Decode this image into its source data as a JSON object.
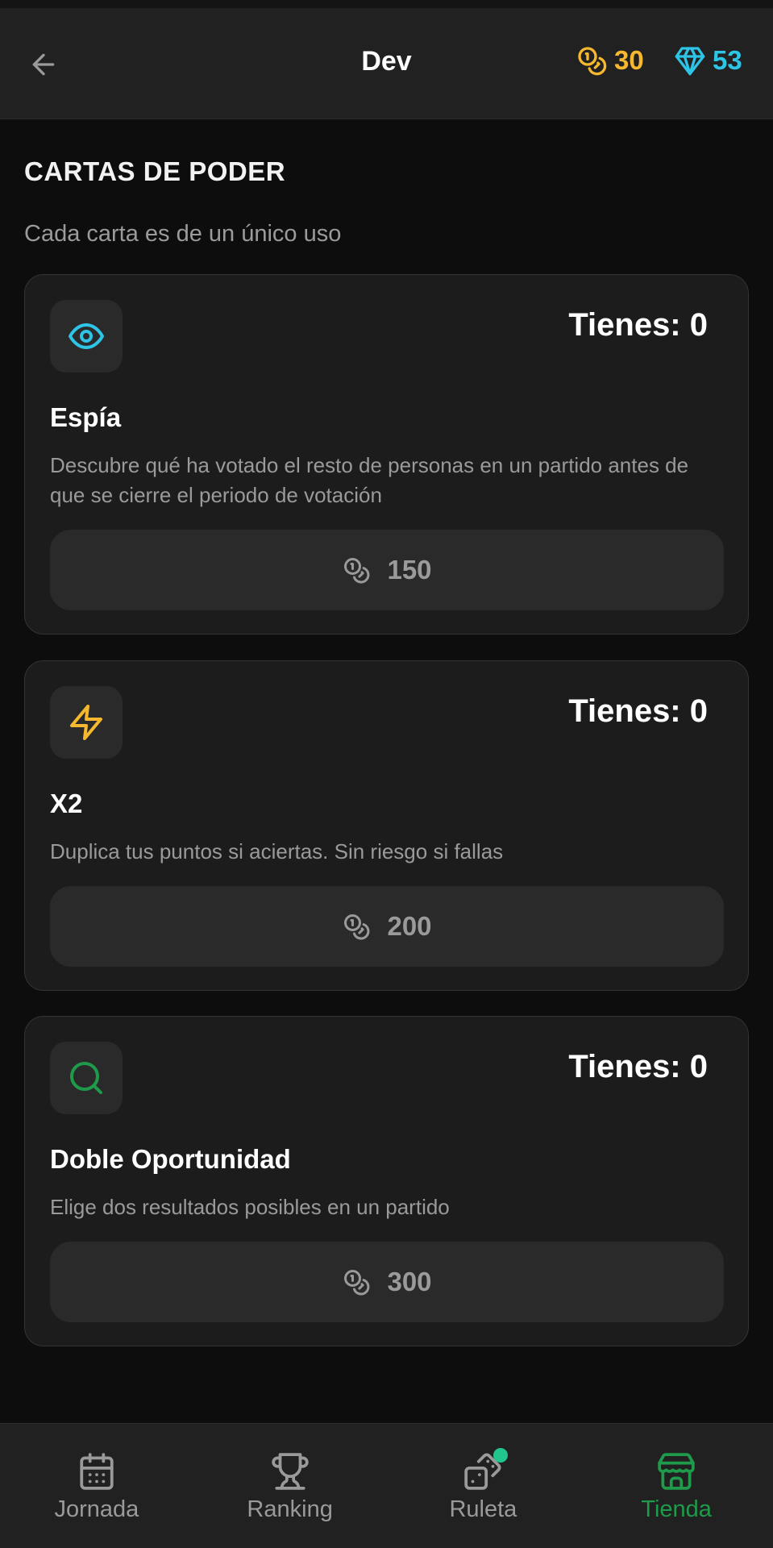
{
  "header": {
    "title": "Dev",
    "coins": "30",
    "gems": "53"
  },
  "section": {
    "title": "CARTAS DE PODER",
    "subtitle": "Cada carta es de un único uso"
  },
  "cards": [
    {
      "icon": "eye-icon",
      "owned": "Tienes: 0",
      "name": "Espía",
      "description": "Descubre qué ha votado el resto de personas en un partido antes de que se cierre el periodo de votación",
      "price": "150",
      "icon_color": "#2ec4e6"
    },
    {
      "icon": "lightning-icon",
      "owned": "Tienes: 0",
      "name": "X2",
      "description": "Duplica tus puntos si aciertas. Sin riesgo si fallas",
      "price": "200",
      "icon_color": "#f5b82e"
    },
    {
      "icon": "search-icon",
      "owned": "Tienes: 0",
      "name": "Doble Oportunidad",
      "description": "Elige dos resultados posibles en un partido",
      "price": "300",
      "icon_color": "#1f9a4a"
    }
  ],
  "nav": {
    "items": [
      {
        "label": "Jornada",
        "icon": "calendar-icon"
      },
      {
        "label": "Ranking",
        "icon": "trophy-icon"
      },
      {
        "label": "Ruleta",
        "icon": "dice-icon"
      },
      {
        "label": "Tienda",
        "icon": "store-icon"
      }
    ],
    "active": "Tienda"
  },
  "colors": {
    "coin": "#f5b82e",
    "gem": "#2ec4e6",
    "active_nav": "#1f9a4a",
    "notification_dot": "#22c58b"
  }
}
